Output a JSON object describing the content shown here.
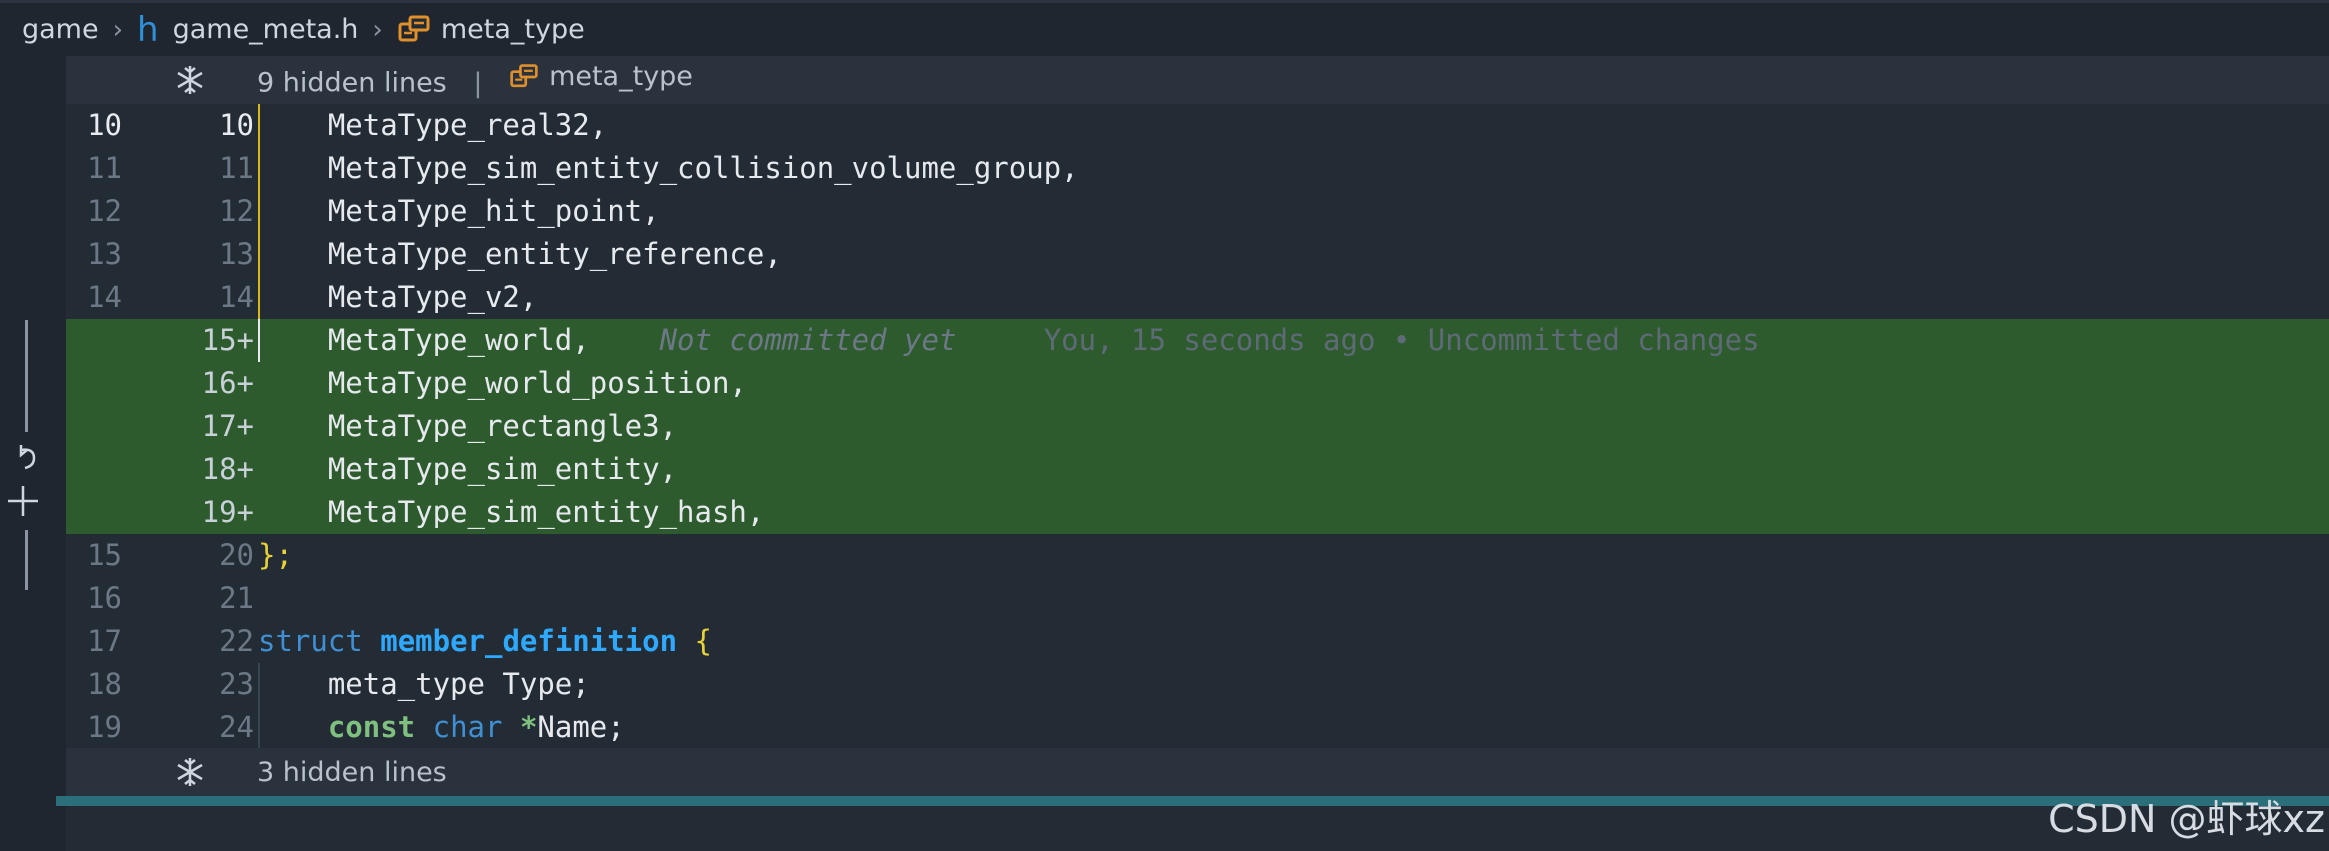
{
  "breadcrumb": {
    "folder": "game",
    "file": "game_meta.h",
    "file_icon_glyph": "h",
    "symbol": "meta_type"
  },
  "hidden_top": {
    "label": "9 hidden lines",
    "context": "meta_type"
  },
  "hidden_bottom": {
    "label": "3 hidden lines"
  },
  "lines": [
    {
      "old": "10",
      "new": "10",
      "text": "    MetaType_real32,"
    },
    {
      "old": "11",
      "new": "11",
      "text": "    MetaType_sim_entity_collision_volume_group,"
    },
    {
      "old": "12",
      "new": "12",
      "text": "    MetaType_hit_point,"
    },
    {
      "old": "13",
      "new": "13",
      "text": "    MetaType_entity_reference,"
    },
    {
      "old": "14",
      "new": "14",
      "text": "    MetaType_v2,"
    },
    {
      "old": "",
      "new": "15+",
      "text": "    MetaType_world,"
    },
    {
      "old": "",
      "new": "16+",
      "text": "    MetaType_world_position,"
    },
    {
      "old": "",
      "new": "17+",
      "text": "    MetaType_rectangle3,"
    },
    {
      "old": "",
      "new": "18+",
      "text": "    MetaType_sim_entity,"
    },
    {
      "old": "",
      "new": "19+",
      "text": "    MetaType_sim_entity_hash,"
    },
    {
      "old": "15",
      "new": "20",
      "text": "};"
    },
    {
      "old": "16",
      "new": "21",
      "text": ""
    },
    {
      "old": "17",
      "new": "22",
      "kw": "struct",
      "name": "member_definition",
      "brace": "{"
    },
    {
      "old": "18",
      "new": "23",
      "text": "    meta_type Type;"
    },
    {
      "old": "19",
      "new": "24",
      "kw": "const",
      "type": "char",
      "star": "*",
      "rest": "Name;"
    }
  ],
  "blame": {
    "line_index": 5,
    "status": "Not committed yet",
    "detail": "You, 15 seconds ago • Uncommitted changes"
  },
  "colors": {
    "added_bg": "#2d5b2e",
    "editor_bg": "#232b35",
    "keyword": "#3f8fd2",
    "function": "#2fa8ff",
    "brace": "#e8d23a"
  },
  "watermark": "CSDN @虾球xz"
}
